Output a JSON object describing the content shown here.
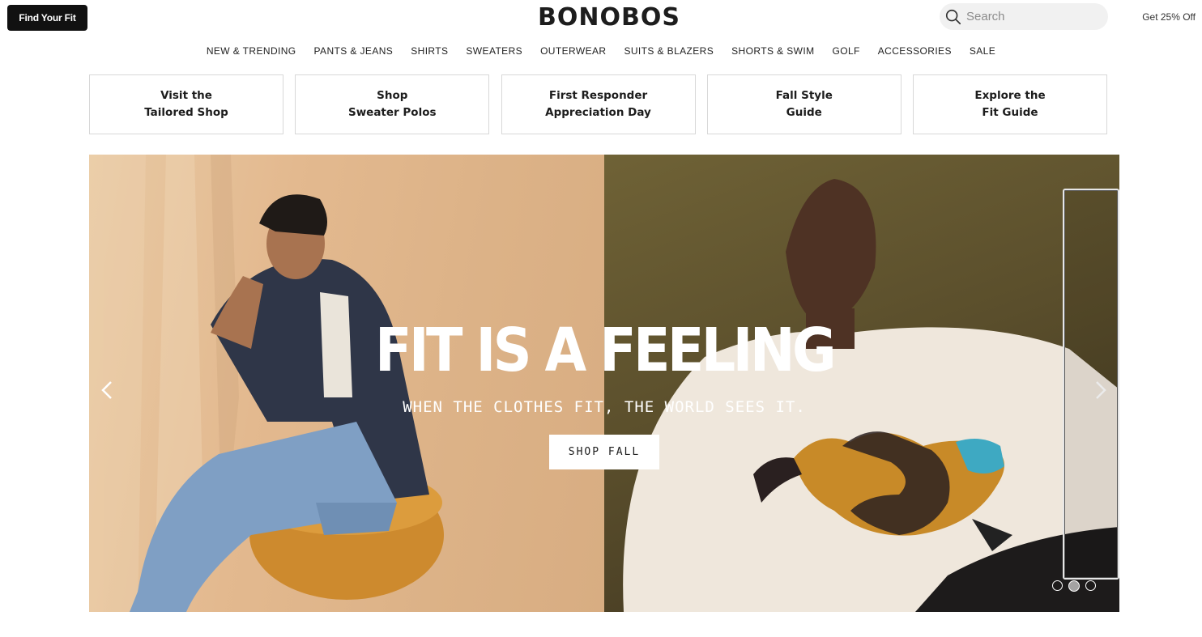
{
  "header": {
    "find_fit_label": "Find Your Fit",
    "logo": "BONOBOS",
    "search_placeholder": "Search",
    "promo_label": "Get 25% Off"
  },
  "nav": {
    "items": [
      "NEW & TRENDING",
      "PANTS & JEANS",
      "SHIRTS",
      "SWEATERS",
      "OUTERWEAR",
      "SUITS & BLAZERS",
      "SHORTS & SWIM",
      "GOLF",
      "ACCESSORIES",
      "SALE"
    ]
  },
  "tiles": [
    {
      "line1": "Visit the",
      "line2": "Tailored Shop"
    },
    {
      "line1": "Shop",
      "line2": "Sweater Polos"
    },
    {
      "line1": "First Responder",
      "line2": "Appreciation Day"
    },
    {
      "line1": "Fall Style",
      "line2": "Guide"
    },
    {
      "line1": "Explore the",
      "line2": "Fit Guide"
    }
  ],
  "hero": {
    "headline": "FIT IS A FEELING",
    "subline": "WHEN THE CLOTHES FIT, THE WORLD SEES IT.",
    "cta_label": "SHOP FALL",
    "slide_count": 3,
    "active_slide": 2
  },
  "colors": {
    "header_button": "#111111",
    "left_panel": "#e3b98f",
    "right_panel": "#5b4f2c"
  }
}
